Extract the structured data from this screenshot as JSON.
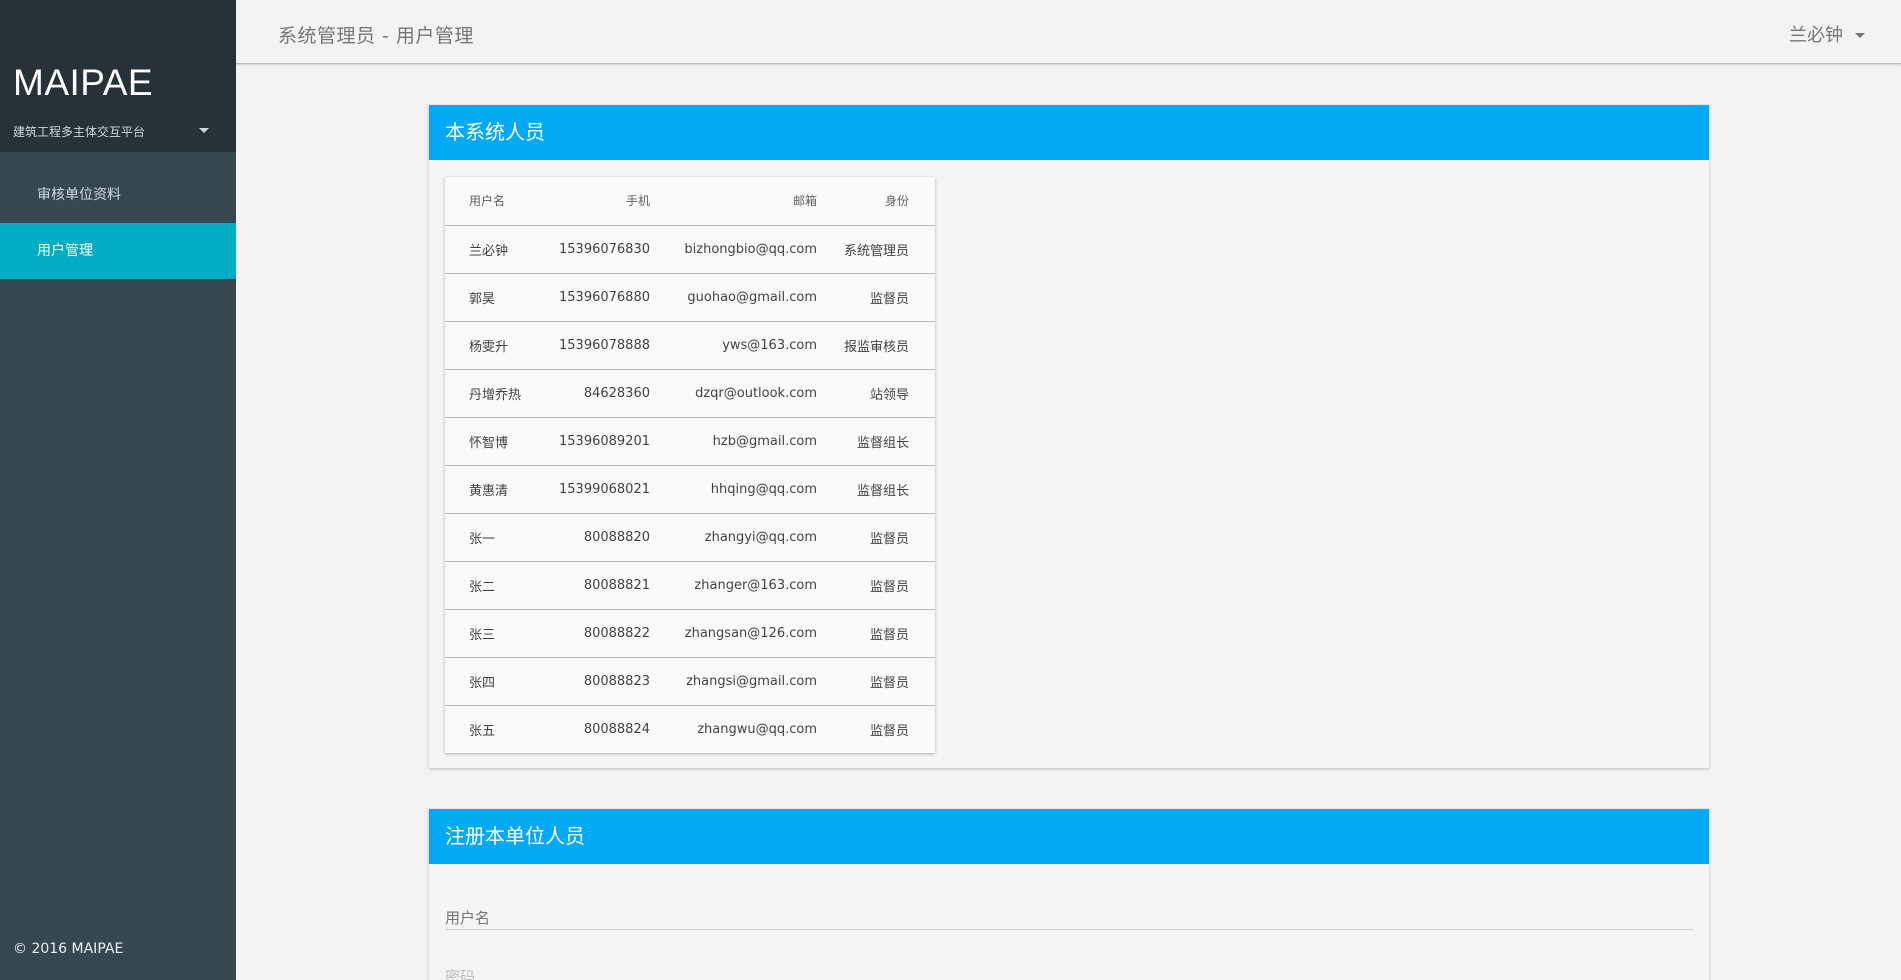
{
  "sidebar": {
    "brand": "MAIPAE",
    "subtitle": "建筑工程多主体交互平台",
    "items": [
      {
        "label": "审核单位资料"
      },
      {
        "label": "用户管理"
      }
    ],
    "footer": "© 2016 MAIPAE"
  },
  "header": {
    "title": "系统管理员 - 用户管理",
    "user": "兰必钟"
  },
  "users_card": {
    "title": "本系统人员",
    "columns": [
      "用户名",
      "手机",
      "邮箱",
      "身份"
    ],
    "rows": [
      [
        "兰必钟",
        "15396076830",
        "bizhongbio@qq.com",
        "系统管理员"
      ],
      [
        "郭昊",
        "15396076880",
        "guohao@gmail.com",
        "监督员"
      ],
      [
        "杨雯升",
        "15396078888",
        "yws@163.com",
        "报监审核员"
      ],
      [
        "丹增乔热",
        "84628360",
        "dzqr@outlook.com",
        "站领导"
      ],
      [
        "怀智博",
        "15396089201",
        "hzb@gmail.com",
        "监督组长"
      ],
      [
        "黄惠清",
        "15399068021",
        "hhqing@qq.com",
        "监督组长"
      ],
      [
        "张一",
        "80088820",
        "zhangyi@qq.com",
        "监督员"
      ],
      [
        "张二",
        "80088821",
        "zhanger@163.com",
        "监督员"
      ],
      [
        "张三",
        "80088822",
        "zhangsan@126.com",
        "监督员"
      ],
      [
        "张四",
        "80088823",
        "zhangsi@gmail.com",
        "监督员"
      ],
      [
        "张五",
        "80088824",
        "zhangwu@qq.com",
        "监督员"
      ]
    ]
  },
  "register_card": {
    "title": "注册本单位人员",
    "username_placeholder": "用户名",
    "second_field_placeholder": "密码"
  },
  "colors": {
    "sidebar_bg": "#37474f",
    "sidebar_header_bg": "#263238",
    "active_item": "#00acc1",
    "card_header": "#03a9f4"
  }
}
